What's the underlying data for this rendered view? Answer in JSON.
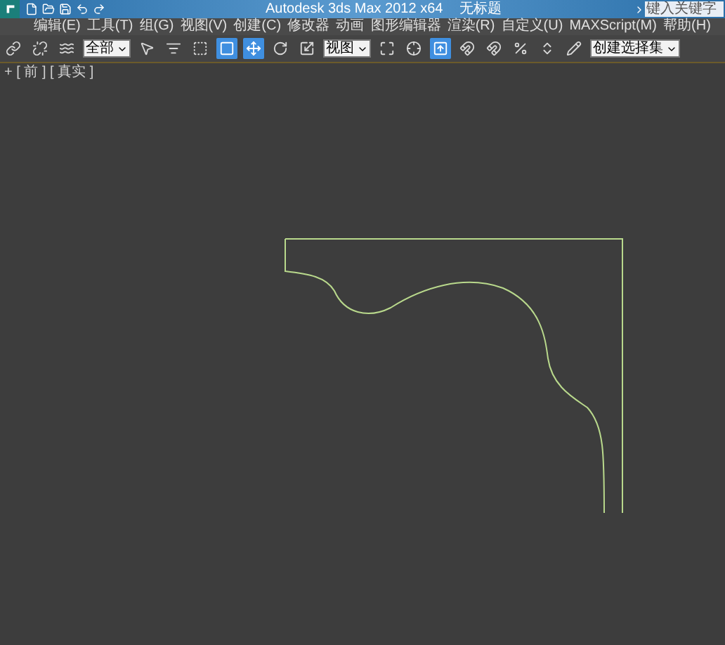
{
  "window": {
    "title": "Autodesk 3ds Max  2012 x64",
    "document": "无标题"
  },
  "search": {
    "placeholder": "键入关键字"
  },
  "menu": [
    "编辑(E)",
    "工具(T)",
    "组(G)",
    "视图(V)",
    "创建(C)",
    "修改器",
    "动画",
    "图形编辑器",
    "渲染(R)",
    "自定义(U)",
    "MAXScript(M)",
    "帮助(H)"
  ],
  "toolbar": [
    {
      "kind": "icon",
      "selected": false
    },
    {
      "kind": "icon",
      "selected": false
    },
    {
      "kind": "icon",
      "selected": false
    },
    {
      "kind": "dropdown",
      "value": "全部"
    },
    {
      "kind": "icon",
      "selected": false
    },
    {
      "kind": "icon",
      "selected": false
    },
    {
      "kind": "icon",
      "selected": false
    },
    {
      "kind": "icon",
      "selected": true
    },
    {
      "kind": "icon",
      "selected": true
    },
    {
      "kind": "icon",
      "selected": false
    },
    {
      "kind": "icon",
      "selected": false
    },
    {
      "kind": "dropdown",
      "value": "视图"
    },
    {
      "kind": "icon",
      "selected": false
    },
    {
      "kind": "icon",
      "selected": false
    },
    {
      "kind": "icon",
      "selected": true
    },
    {
      "kind": "icon",
      "selected": false
    },
    {
      "kind": "icon",
      "selected": false
    },
    {
      "kind": "icon",
      "selected": false
    },
    {
      "kind": "icon",
      "selected": false
    },
    {
      "kind": "icon",
      "selected": false
    },
    {
      "kind": "dropdown",
      "value": "创建选择集"
    }
  ],
  "viewport": {
    "label": "+ [ 前 ] [ 真实 ]"
  }
}
